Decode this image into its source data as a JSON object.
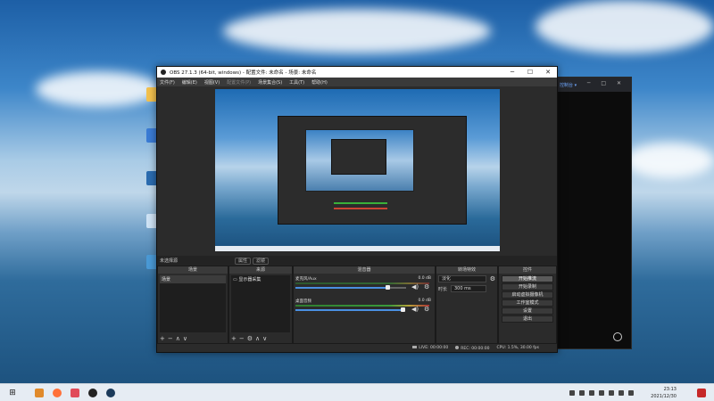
{
  "obs": {
    "title": "OBS 27.1.3 (64-bit, windows) - 配置文件: 未命名 - 场景: 未命名",
    "window_controls": [
      "─",
      "☐",
      "✕"
    ],
    "menu": [
      {
        "label": "文件(F)",
        "enabled": true
      },
      {
        "label": "编辑(E)",
        "enabled": true
      },
      {
        "label": "视图(V)",
        "enabled": true
      },
      {
        "label": "配置文件(P)",
        "enabled": false
      },
      {
        "label": "场景集合(S)",
        "enabled": true
      },
      {
        "label": "工具(T)",
        "enabled": true
      },
      {
        "label": "帮助(H)",
        "enabled": true
      }
    ],
    "scene_toolbar": {
      "label": "未选择源",
      "properties": "属性",
      "filters": "滤镜"
    },
    "docks": {
      "scenes": {
        "title": "场景",
        "items": [
          "场景"
        ]
      },
      "sources": {
        "title": "来源",
        "items": [
          "显示器采集"
        ]
      },
      "mixer": {
        "title": "混音器",
        "channels": [
          {
            "name": "麦克风/Aux",
            "db": "0.0 dB"
          },
          {
            "name": "桌面音频",
            "db": "0.0 dB"
          }
        ]
      },
      "transitions": {
        "title": "转场特效",
        "type": "淡化",
        "duration_label": "时长",
        "duration_value": "300 ms"
      },
      "controls": {
        "title": "控件",
        "buttons": [
          "开始推流",
          "开始录制",
          "启动虚拟摄像机",
          "工作室模式",
          "设置",
          "退出"
        ]
      }
    },
    "footer_glyphs": {
      "add": "+",
      "remove": "−",
      "up": "∧",
      "down": "∨",
      "gear": "⚙"
    },
    "status": {
      "live": "LIVE: 00:00:00",
      "rec": "REC: 00:00:00",
      "cpu": "CPU: 1.5%, 30.00 fps"
    }
  },
  "bg_window": {
    "tab": "控制台 ▾",
    "controls": "─ □ ✕"
  },
  "taskbar": {
    "time": "23:13",
    "date": "2021/12/30"
  }
}
